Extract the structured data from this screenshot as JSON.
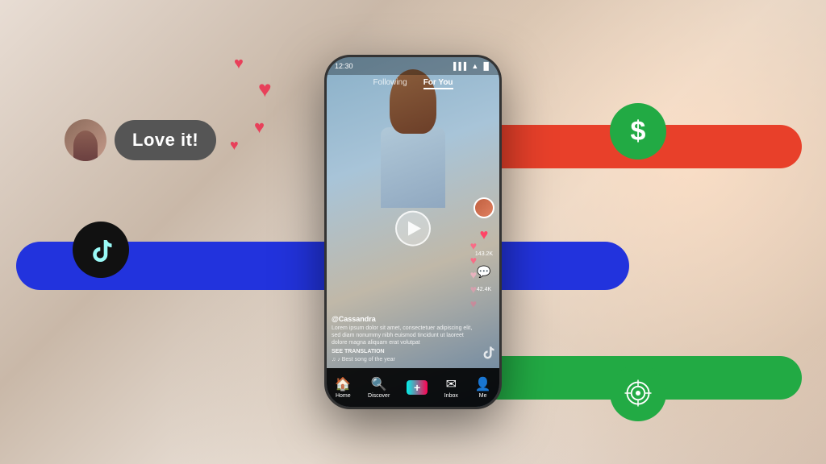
{
  "background": {
    "alt": "Blurred woman smiling holding phone"
  },
  "loveBubble": {
    "text": "Love it!",
    "avatarAlt": "User avatar"
  },
  "bars": {
    "red": {
      "color": "#e8402a"
    },
    "blue": {
      "color": "#2233dd"
    },
    "green": {
      "color": "#22aa44"
    }
  },
  "circles": {
    "dollar": {
      "symbol": "$",
      "color": "#22aa44"
    },
    "tiktok": {
      "color": "#111111"
    },
    "target": {
      "color": "#22aa44"
    }
  },
  "phone": {
    "statusBar": {
      "time": "12:30",
      "signal": "▌▌▌",
      "wifi": "▲",
      "battery": "▐"
    },
    "navTabs": {
      "following": "Following",
      "forYou": "For You"
    },
    "video": {
      "username": "@Cassandra",
      "caption": "Lorem ipsum dolor sit amet, consectetuer adipiscing elit, sed diam nonummy nibh euismod tincidunt ut laoreet dolore magna aliquam erat volutpat",
      "translation": "SEE TRANSLATION",
      "music": "♪ Best song of the year",
      "likes": "143.2K",
      "comments": "42.4K"
    },
    "bottomNav": [
      {
        "icon": "🏠",
        "label": "Home"
      },
      {
        "icon": "🔍",
        "label": "Discover"
      },
      {
        "icon": "+",
        "label": ""
      },
      {
        "icon": "✉",
        "label": "Inbox"
      },
      {
        "icon": "👤",
        "label": "Me"
      }
    ]
  },
  "hearts": [
    "♥",
    "♥",
    "♥",
    "♥"
  ]
}
